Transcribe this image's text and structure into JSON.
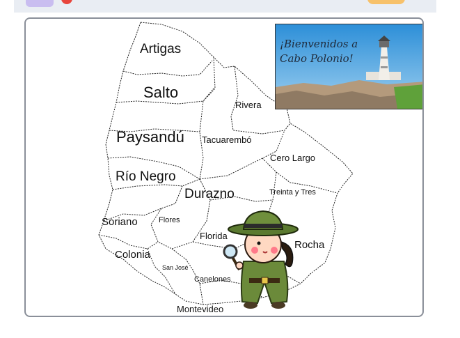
{
  "toolbar": {
    "green_flag_icon": "green-flag-icon",
    "stop_icon": "stop-icon"
  },
  "photo": {
    "caption_line1": "¡Bienvenidos a",
    "caption_line2": "Cabo Polonio!"
  },
  "departments": [
    "Artigas",
    "Salto",
    "Rivera",
    "Paysandú",
    "Tacuarembó",
    "Cero Largo",
    "Río Negro",
    "Durazno",
    "Treinta y Tres",
    "Soriano",
    "Flores",
    "Florida",
    "Rocha",
    "Colonia",
    "San José",
    "Canelones",
    "Montevideo"
  ],
  "colors": {
    "stage_border": "#8a8f99",
    "toolbar_bg": "#e9edf3",
    "sky_top": "#2d8fd8",
    "grass": "#5fa13a"
  }
}
